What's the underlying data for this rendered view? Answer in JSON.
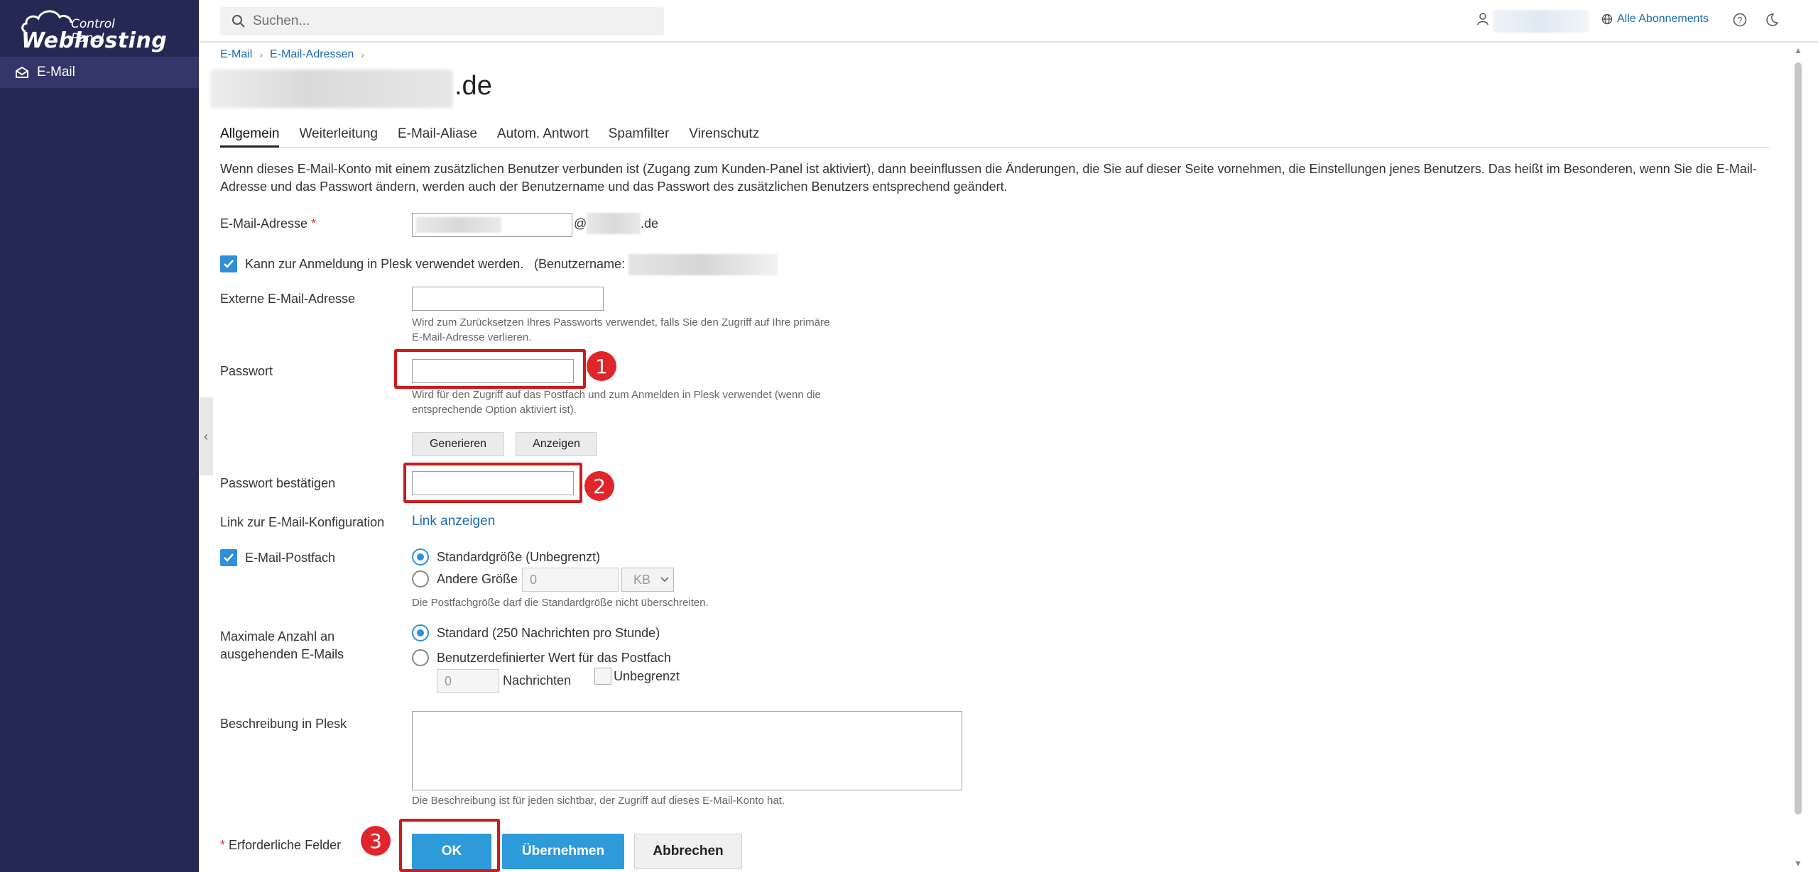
{
  "logo": {
    "top": "Control Panel",
    "main": "Webhosting"
  },
  "sidebar": {
    "items": [
      {
        "label": "E-Mail"
      }
    ]
  },
  "topbar": {
    "search_placeholder": "Suchen...",
    "subscriptions": "Alle Abonnements"
  },
  "breadcrumb": [
    "E-Mail",
    "E-Mail-Adressen"
  ],
  "page": {
    "title_suffix": ".de"
  },
  "tabs": [
    "Allgemein",
    "Weiterleitung",
    "E-Mail-Aliase",
    "Autom. Antwort",
    "Spamfilter",
    "Virenschutz"
  ],
  "info_text": "Wenn dieses E-Mail-Konto mit einem zusätzlichen Benutzer verbunden ist (Zugang zum Kunden-Panel ist aktiviert), dann beeinflussen die Änderungen, die Sie auf dieser Seite vornehmen, die Einstellungen jenes Benutzers. Das heißt im Besonderen, wenn Sie die E-Mail-Adresse und das Passwort ändern, werden auch der Benutzername und das Passwort des zusätzlichen Benutzers entsprechend geändert.",
  "form": {
    "email_label": "E-Mail-Adresse",
    "required_mark": "*",
    "at": "@",
    "domain_suffix": ".de",
    "plesk_login_label": "Kann zur Anmeldung in Plesk verwendet werden.",
    "username_label": "(Benutzername:",
    "external_email_label": "Externe E-Mail-Adresse",
    "external_email_hint_1": "Wird zum Zurücksetzen Ihres Passworts verwendet, falls Sie den Zugriff auf Ihre primäre",
    "external_email_hint_2": "E-Mail-Adresse verlieren.",
    "password_label": "Passwort",
    "password_hint_1": "Wird für den Zugriff auf das Postfach und zum Anmelden in Plesk verwendet (wenn die",
    "password_hint_2": "entsprechende Option aktiviert ist).",
    "generate_button": "Generieren",
    "show_button": "Anzeigen",
    "confirm_password_label": "Passwort bestätigen",
    "config_link_label": "Link zur E-Mail-Konfiguration",
    "config_link": "Link anzeigen",
    "mailbox_label": "E-Mail-Postfach",
    "mailbox_default": "Standardgröße (Unbegrenzt)",
    "mailbox_other": "Andere Größe",
    "mailbox_size_value": "0",
    "mailbox_unit": "KB",
    "mailbox_hint": "Die Postfachgröße darf die Standardgröße nicht überschreiten.",
    "max_outgoing_label_1": "Maximale Anzahl an",
    "max_outgoing_label_2": "ausgehenden E-Mails",
    "max_outgoing_default": "Standard (250 Nachrichten pro Stunde)",
    "max_outgoing_custom": "Benutzerdefinierter Wert für das Postfach",
    "max_outgoing_value": "0",
    "messages_label": "Nachrichten",
    "unlimited_label": "Unbegrenzt",
    "description_label": "Beschreibung in Plesk",
    "description_hint": "Die Beschreibung ist für jeden sichtbar, der Zugriff auf dieses E-Mail-Konto hat.",
    "required_fields": "Erforderliche Felder"
  },
  "buttons": {
    "ok": "OK",
    "apply": "Übernehmen",
    "cancel": "Abbrechen"
  },
  "annotations": [
    "1",
    "2",
    "3"
  ],
  "colors": {
    "sidebar": "#262854",
    "accent": "#2d9ad9",
    "link": "#1e6ab0",
    "annotation": "#cc1a1f"
  }
}
